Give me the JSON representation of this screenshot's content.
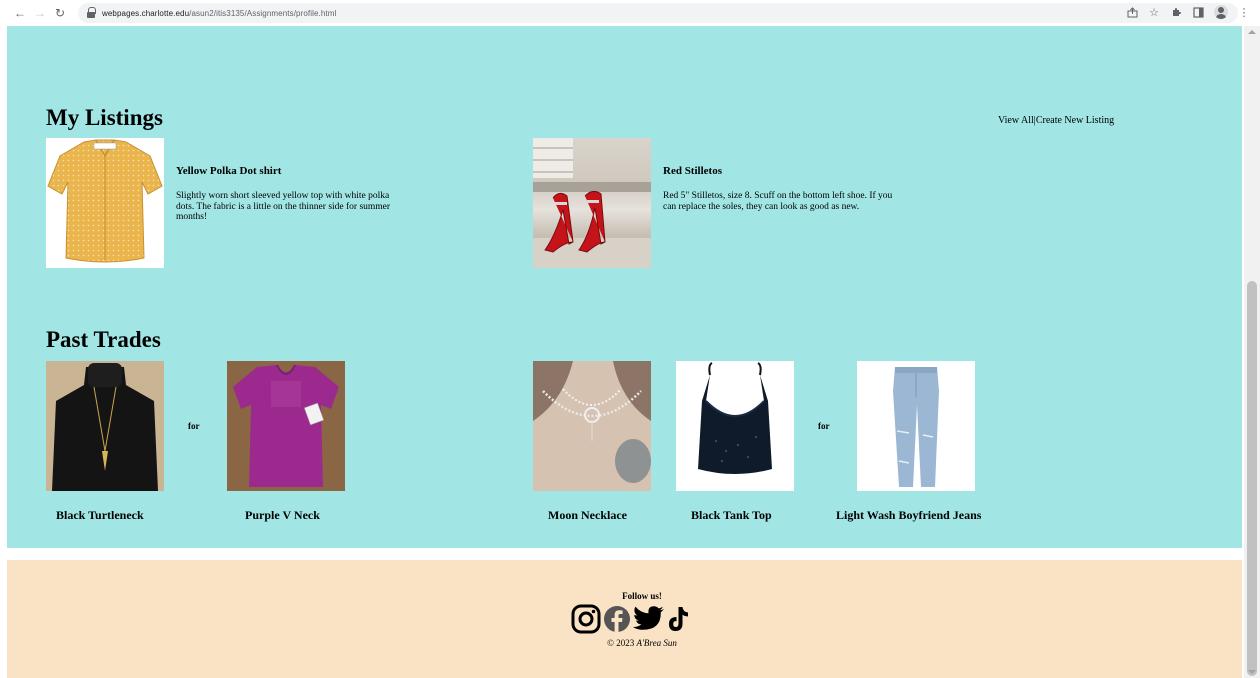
{
  "browser": {
    "url_host": "webpages.charlotte.edu",
    "url_path": "/asun2/itis3135/Assignments/profile.html"
  },
  "listings": {
    "title": "My Listings",
    "view_all": "View All",
    "separator": "|",
    "create_new": "Create New Listing",
    "items": [
      {
        "name": "Yellow Polka Dot shirt",
        "description": "Slightly worn short sleeved yellow top with white polka dots. The fabric is a little on the thinner side for summer months!"
      },
      {
        "name": "Red Stilletos",
        "description": "Red 5\" Stilletos, size 8. Scuff on the bottom left shoe. If you can replace the soles, they can look as good as new."
      }
    ]
  },
  "trades": {
    "title": "Past Trades",
    "for_label": "for",
    "items": [
      {
        "gave": "Black Turtleneck",
        "got": "Purple V Neck"
      },
      {
        "gave_1": "Moon Necklace",
        "gave_2": "Black Tank Top",
        "got": "Light Wash Boyfriend Jeans"
      }
    ]
  },
  "footer": {
    "follow": "Follow us!",
    "copyright_prefix": "© 2023",
    "copyright_name": "A'Brea Sun",
    "socials": [
      "instagram-icon",
      "facebook-icon",
      "twitter-icon",
      "tiktok-icon"
    ]
  },
  "colors": {
    "main_bg": "#a2e5e5",
    "footer_bg": "#fae3c4"
  }
}
